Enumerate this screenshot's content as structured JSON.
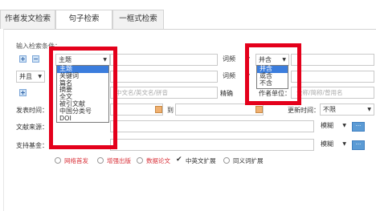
{
  "tabs": [
    "作者发文检索",
    "句子检索",
    "一框式检索"
  ],
  "section_title": "输入检索条件：",
  "row1": {
    "field_select": "主题",
    "field_options": [
      "主题",
      "关键词",
      "篇名",
      "摘要",
      "全文",
      "被引文献",
      "中国分类号",
      "DOI"
    ],
    "match_select": "词频",
    "logic_select": "并含",
    "logic_options": [
      "并含",
      "或含",
      "不含"
    ]
  },
  "row2": {
    "logic_select": "并且",
    "match_select": "词频"
  },
  "row3": {
    "author_placeholder": "中文名/英文名/拼音",
    "match_label": "精确",
    "unit_label": "作者单位：",
    "unit_placeholder": "全称/简称/曾用名"
  },
  "date": {
    "label": "发表时间：",
    "to_label": "到",
    "update_label": "更新时间：",
    "update_value": "不限"
  },
  "source": {
    "label": "文献来源：",
    "match": "模糊"
  },
  "fund": {
    "label": "支持基金：",
    "match": "模糊"
  },
  "options": [
    {
      "label": "网络首发",
      "checked": false,
      "color": "#d9323a"
    },
    {
      "label": "增强出版",
      "checked": false,
      "color": "#d9323a"
    },
    {
      "label": "数据论文",
      "checked": false,
      "color": "#d9323a"
    },
    {
      "label": "中英文扩展",
      "checked": true,
      "color": "#333333"
    },
    {
      "label": "同义词扩展",
      "checked": false,
      "color": "#333333"
    }
  ],
  "more_button": "···",
  "plus_icon": "+",
  "minus_icon": "−"
}
